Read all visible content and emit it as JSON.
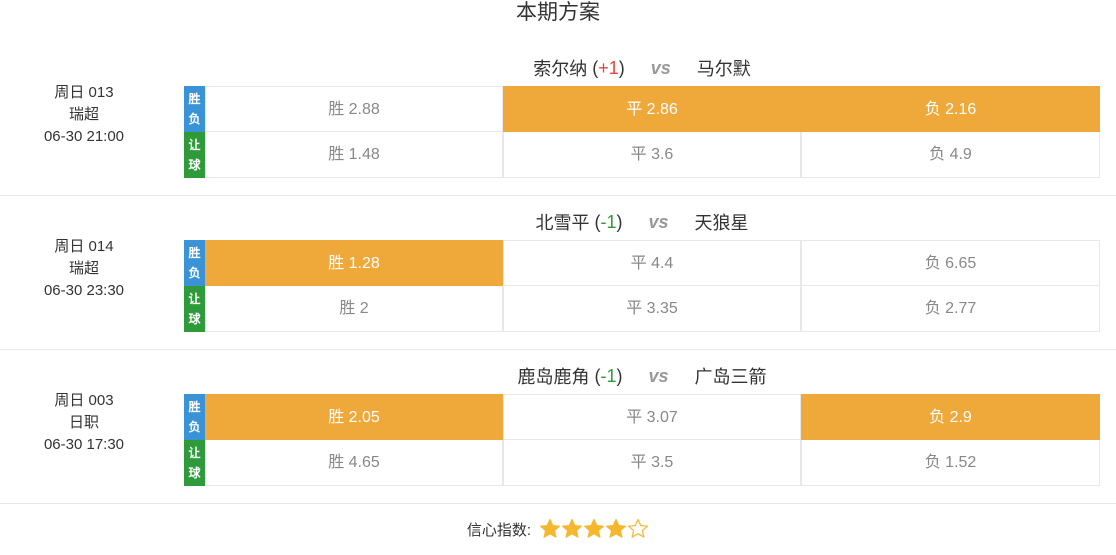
{
  "page_title": "本期方案",
  "labels": {
    "spf_tag": [
      "胜",
      "负"
    ],
    "rq_tag": [
      "让",
      "球"
    ]
  },
  "matches": [
    {
      "week": "周日 013",
      "league": "瑞超",
      "time": "06-30 21:00",
      "home": "索尔纳",
      "handicap": "+1",
      "handicap_sign": "pos",
      "vs": "vs",
      "away": "马尔默",
      "spf": [
        {
          "label": "胜 2.88",
          "selected": false
        },
        {
          "label": "平 2.86",
          "selected": true
        },
        {
          "label": "负 2.16",
          "selected": true
        }
      ],
      "rq": [
        {
          "label": "胜 1.48",
          "selected": false
        },
        {
          "label": "平 3.6",
          "selected": false
        },
        {
          "label": "负 4.9",
          "selected": false
        }
      ]
    },
    {
      "week": "周日 014",
      "league": "瑞超",
      "time": "06-30 23:30",
      "home": "北雪平",
      "handicap": "-1",
      "handicap_sign": "neg",
      "vs": "vs",
      "away": "天狼星",
      "spf": [
        {
          "label": "胜 1.28",
          "selected": true
        },
        {
          "label": "平 4.4",
          "selected": false
        },
        {
          "label": "负 6.65",
          "selected": false
        }
      ],
      "rq": [
        {
          "label": "胜 2",
          "selected": false
        },
        {
          "label": "平 3.35",
          "selected": false
        },
        {
          "label": "负 2.77",
          "selected": false
        }
      ]
    },
    {
      "week": "周日 003",
      "league": "日职",
      "time": "06-30 17:30",
      "home": "鹿岛鹿角",
      "handicap": "-1",
      "handicap_sign": "neg",
      "vs": "vs",
      "away": "广岛三箭",
      "spf": [
        {
          "label": "胜 2.05",
          "selected": true
        },
        {
          "label": "平 3.07",
          "selected": false
        },
        {
          "label": "负 2.9",
          "selected": true
        }
      ],
      "rq": [
        {
          "label": "胜 4.65",
          "selected": false
        },
        {
          "label": "平 3.5",
          "selected": false
        },
        {
          "label": "负 1.52",
          "selected": false
        }
      ]
    }
  ],
  "confidence": {
    "label": "信心指数:",
    "rating": 4,
    "max": 5
  },
  "colors": {
    "selected": "#efa83a",
    "tag_blue": "#3b93d7",
    "tag_green": "#2e9a3a",
    "handicap_pos": "#e2463a",
    "handicap_neg": "#2e9a3a",
    "star": "#f5b72e"
  },
  "icons": {
    "star_filled": "star-filled-icon",
    "star_empty": "star-empty-icon"
  }
}
